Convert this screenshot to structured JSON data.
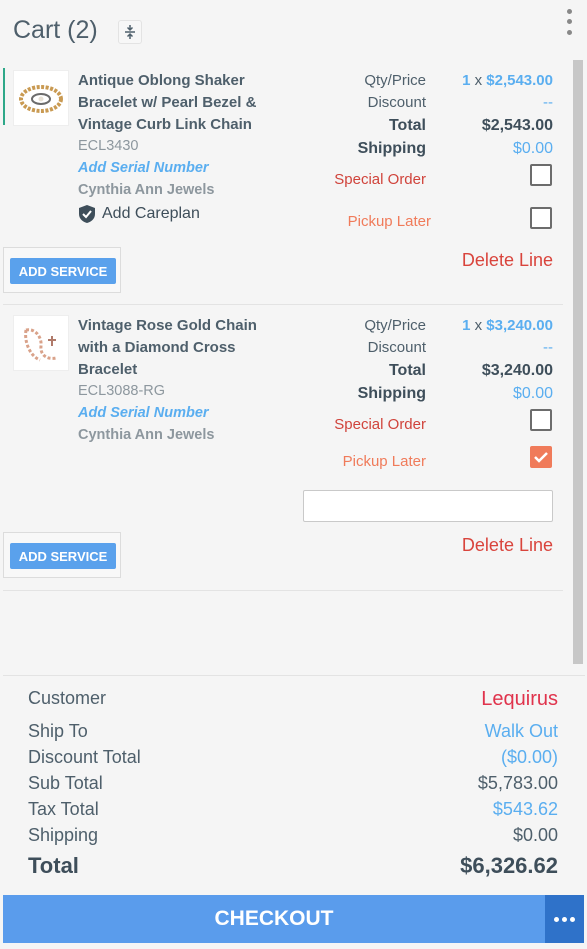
{
  "header": {
    "title": "Cart (2)"
  },
  "items": [
    {
      "name": "Antique Oblong Shaker Bracelet w/ Pearl Bezel & Vintage Curb Link Chain",
      "sku": "ECL3430",
      "serial_label": "Add Serial Number",
      "vendor": "Cynthia Ann Jewels",
      "careplan_label": "Add Careplan",
      "qty_label": "Qty/Price",
      "qty": "1",
      "qty_x": "x",
      "price": "$2,543.00",
      "discount_label": "Discount",
      "discount": "--",
      "total_label": "Total",
      "total": "$2,543.00",
      "shipping_label": "Shipping",
      "shipping": "$0.00",
      "special_order_label": "Special Order",
      "special_order": false,
      "pickup_later_label": "Pickup Later",
      "pickup_later": false,
      "add_service_label": "ADD SERVICE",
      "delete_label": "Delete Line"
    },
    {
      "name": "Vintage Rose Gold Chain with a Diamond Cross Bracelet",
      "sku": "ECL3088-RG",
      "serial_label": "Add Serial Number",
      "vendor": "Cynthia Ann Jewels",
      "qty_label": "Qty/Price",
      "qty": "1",
      "qty_x": "x",
      "price": "$3,240.00",
      "discount_label": "Discount",
      "discount": "--",
      "total_label": "Total",
      "total": "$3,240.00",
      "shipping_label": "Shipping",
      "shipping": "$0.00",
      "special_order_label": "Special Order",
      "special_order": false,
      "pickup_later_label": "Pickup Later",
      "pickup_later": true,
      "pickup_note": "",
      "add_service_label": "ADD SERVICE",
      "delete_label": "Delete Line"
    }
  ],
  "summary": {
    "customer_label": "Customer",
    "customer": "Lequirus",
    "ship_to_label": "Ship To",
    "ship_to": "Walk Out",
    "discount_total_label": "Discount Total",
    "discount_total": "($0.00)",
    "sub_total_label": "Sub Total",
    "sub_total": "$5,783.00",
    "tax_total_label": "Tax Total",
    "tax_total": "$543.62",
    "shipping_label": "Shipping",
    "shipping": "$0.00",
    "total_label": "Total",
    "total": "$6,326.62"
  },
  "footer": {
    "checkout_label": "CHECKOUT"
  },
  "colors": {
    "accent_blue": "#5a9cec",
    "link_blue": "#5aaef0",
    "delete_red": "#d9443c",
    "pickup_orange": "#f07b5a"
  }
}
